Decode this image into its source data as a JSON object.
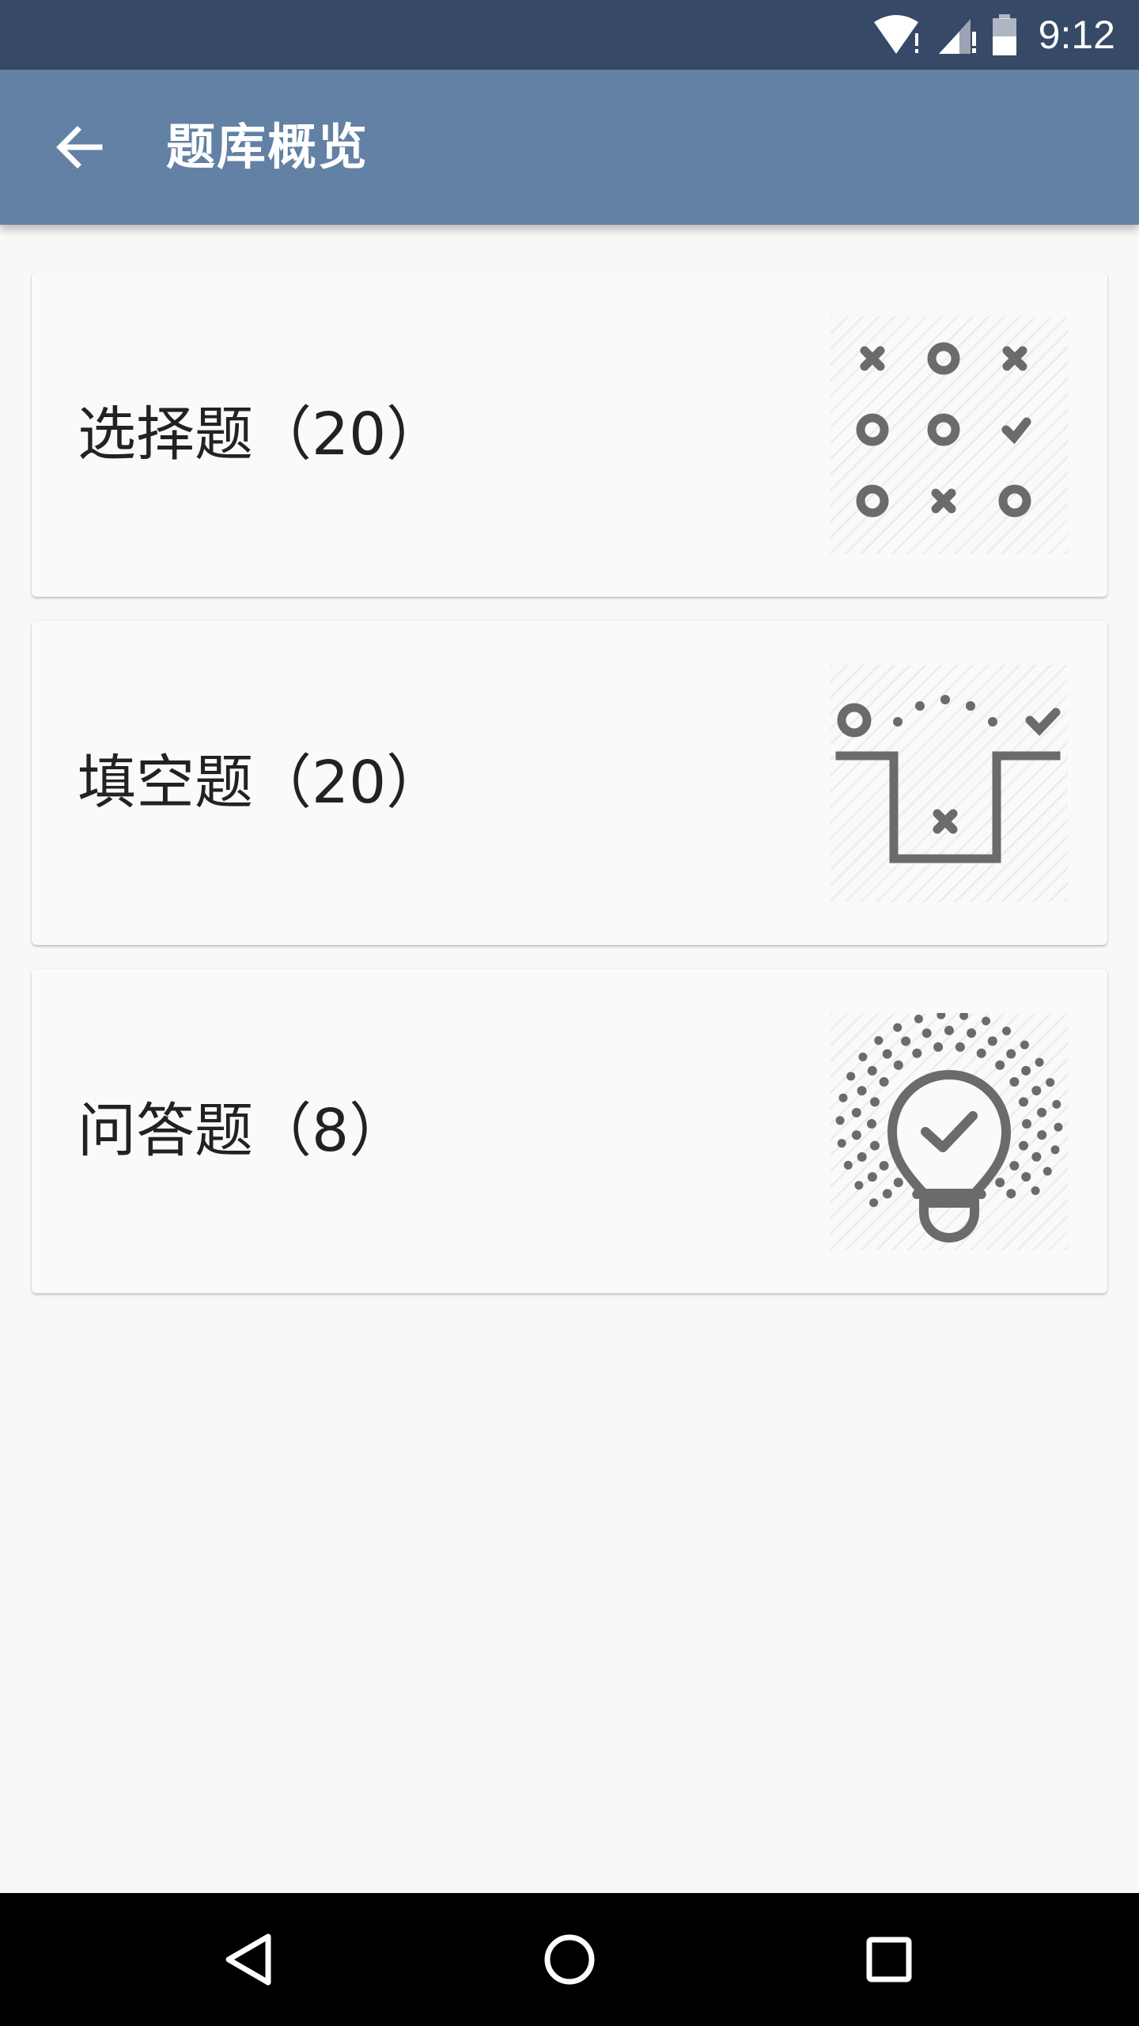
{
  "status_bar": {
    "time": "9:12",
    "icons": [
      "wifi-alert-icon",
      "signal-alert-icon",
      "battery-icon"
    ]
  },
  "app_bar": {
    "title": "题库概览",
    "back_icon": "arrow-back-icon"
  },
  "cards": [
    {
      "label": "选择题（20）",
      "icon": "multiple-choice-grid-icon"
    },
    {
      "label": "填空题（20）",
      "icon": "fill-blank-icon"
    },
    {
      "label": "问答题（8）",
      "icon": "lightbulb-check-icon"
    }
  ],
  "nav_bar": {
    "icons": [
      "nav-back-icon",
      "nav-home-icon",
      "nav-recents-icon"
    ]
  },
  "colors": {
    "status_bar": "#364966",
    "app_bar": "#6380a5",
    "background": "#f8f8f8",
    "illustration": "#6b6b6b"
  }
}
